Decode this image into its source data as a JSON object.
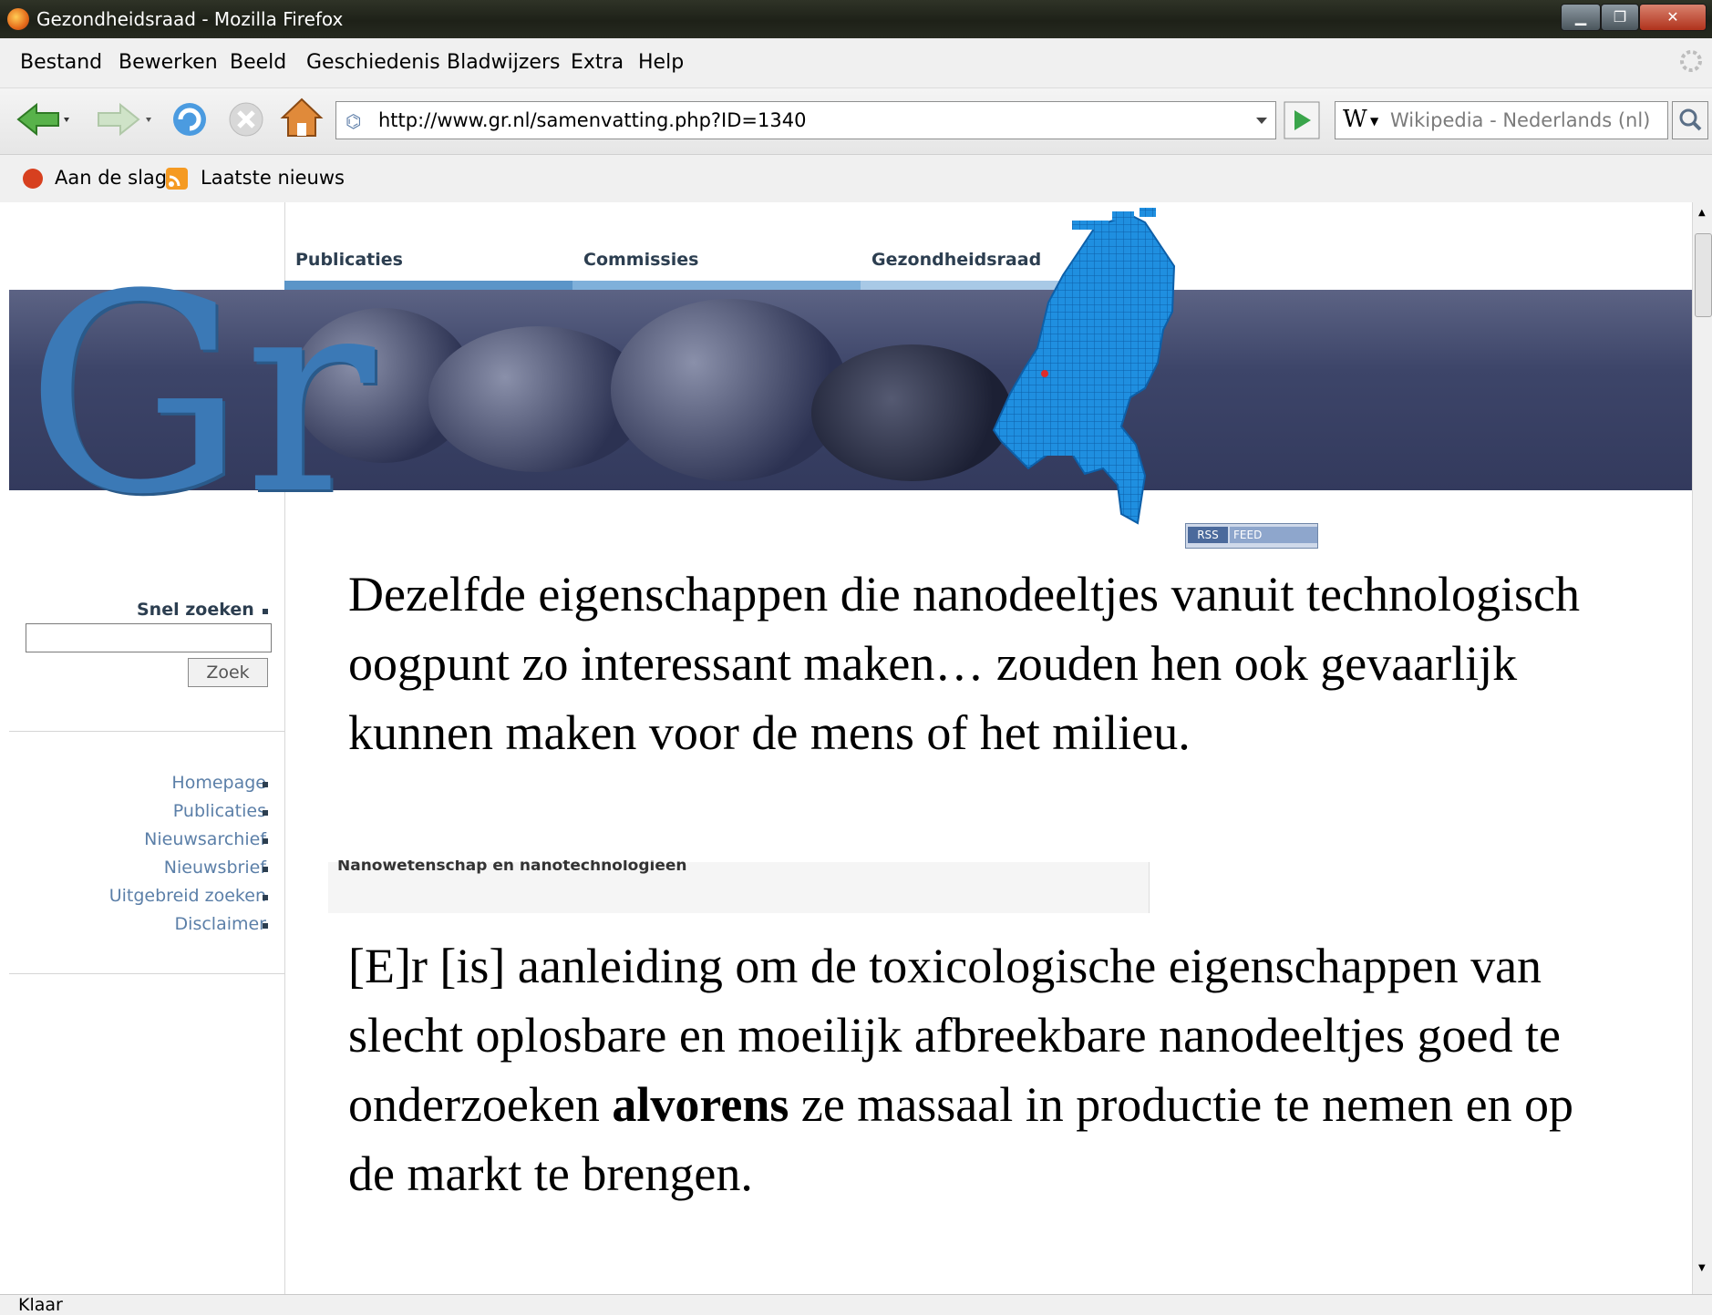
{
  "window": {
    "title": "Gezondheidsraad - Mozilla Firefox"
  },
  "menu": [
    "Bestand",
    "Bewerken",
    "Beeld",
    "Geschiedenis",
    "Bladwijzers",
    "Extra",
    "Help"
  ],
  "navigation": {
    "url": "http://www.gr.nl/samenvatting.php?ID=1340",
    "search_engine_letter": "W",
    "search_placeholder": "Wikipedia - Nederlands (nl)"
  },
  "bookmarks": [
    "Aan de slag",
    "Laatste nieuws"
  ],
  "site": {
    "logo_letters": "Gr",
    "top_nav": [
      "Publicaties",
      "Commissies",
      "Gezondheidsraad"
    ],
    "rss_left": "RSS",
    "rss_right": "FEED",
    "search_label": "Snel zoeken",
    "search_button": "Zoek",
    "side_links": [
      "Homepage",
      "Publicaties",
      "Nieuwsarchief",
      "Nieuwsbrief",
      "Uitgebreid zoeken",
      "Disclaimer"
    ],
    "strip_title": "Nanowetenschap en nanotechnologieën"
  },
  "overlay": {
    "quote1": "Dezelfde eigenschappen die nanodeeltjes vanuit technologisch oogpunt zo interessant maken… zouden hen ook gevaarlijk kunnen maken voor de mens of het milieu.",
    "quote2_part1": "[E]r [is] aanleiding om de toxicologische eigenschappen van slecht oplosbare en moeilijk afbreekbare nanodeeltjes goed te onderzoeken ",
    "quote2_bold": "alvorens",
    "quote2_part2": " ze massaal in productie te nemen en op de markt te brengen."
  },
  "status": "Klaar",
  "colors": {
    "nav_blue": "#5b95c8",
    "map_blue": "#1f8fe0",
    "logo_blue": "#3b79b6",
    "banner": "#3d4569"
  }
}
